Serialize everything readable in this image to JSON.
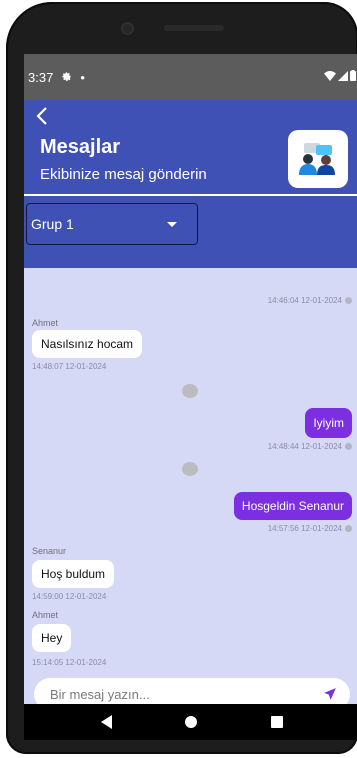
{
  "status_bar": {
    "time": "3:37",
    "settings_icon": "gear-icon",
    "notification_dot": "•",
    "wifi_icon": "wifi-icon",
    "signal_icon": "signal-icon",
    "battery_icon": "battery-icon"
  },
  "header": {
    "back_icon": "chevron-left-icon",
    "title": "Mesajlar",
    "subtitle": "Ekibinize mesaj gönderin",
    "logo_icon": "team-chat-icon"
  },
  "group_select": {
    "selected": "Grup 1"
  },
  "messages": [
    {
      "direction": "out",
      "sender": "",
      "text": "",
      "time": "14:46:04 12-01-2024",
      "read": true
    },
    {
      "direction": "in",
      "sender": "Ahmet",
      "text": "Nasılsınız hocam",
      "time": "14:48:07 12-01-2024"
    },
    {
      "direction": "out",
      "sender": "",
      "text": "Iyiyim",
      "time": "14:48:44 12-01-2024",
      "read": true
    },
    {
      "direction": "out",
      "sender": "",
      "text": "Hosgeldin Senanur",
      "time": "14:57:56 12-01-2024",
      "read": true
    },
    {
      "direction": "in",
      "sender": "Senanur",
      "text": "Hoş buldum",
      "time": "14:59:00 12-01-2024"
    },
    {
      "direction": "in",
      "sender": "Ahmet",
      "text": "Hey",
      "time": "15:14:05 12-01-2024"
    }
  ],
  "input": {
    "placeholder": "Bir mesaj yazın...",
    "value": "",
    "send_icon": "send-icon"
  },
  "colors": {
    "header_bg": "#3f51b5",
    "chat_bg": "#d6d9f6",
    "outgoing_bubble": "#7b2fe0",
    "incoming_bubble": "#ffffff",
    "send_icon": "#7b2fe0"
  },
  "nav": {
    "back_icon": "triangle-back-icon",
    "home_icon": "circle-home-icon",
    "recent_icon": "square-recents-icon"
  }
}
